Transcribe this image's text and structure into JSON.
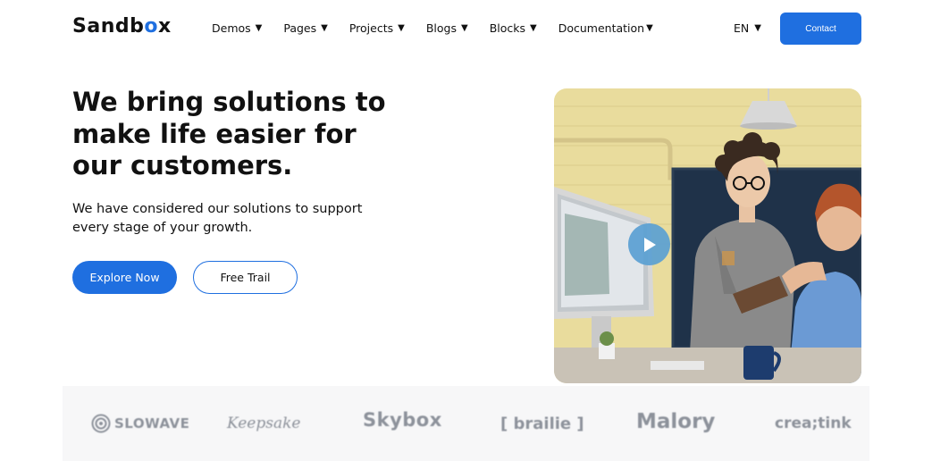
{
  "header": {
    "logo_prefix": "Sandb",
    "logo_o": "o",
    "logo_suffix": "x",
    "nav": [
      {
        "label": "Demos"
      },
      {
        "label": "Pages"
      },
      {
        "label": "Projects"
      },
      {
        "label": "Blogs"
      },
      {
        "label": "Blocks"
      },
      {
        "label": "Documentation"
      }
    ],
    "language": "EN",
    "contact_label": "Contact"
  },
  "hero": {
    "title": "We bring solutions to make life easier for our customers.",
    "subtitle": "We have considered our solutions to support every stage of your growth.",
    "primary_button": "Explore Now",
    "secondary_button": "Free Trail"
  },
  "brands": [
    "SLOWAVE",
    "Keepsake",
    "Skybox",
    "[ brailie ]",
    "Malory",
    "crea;tink"
  ],
  "colors": {
    "accent": "#1f6fe0"
  },
  "icons": {
    "caret": "▼",
    "play": "play-icon"
  }
}
